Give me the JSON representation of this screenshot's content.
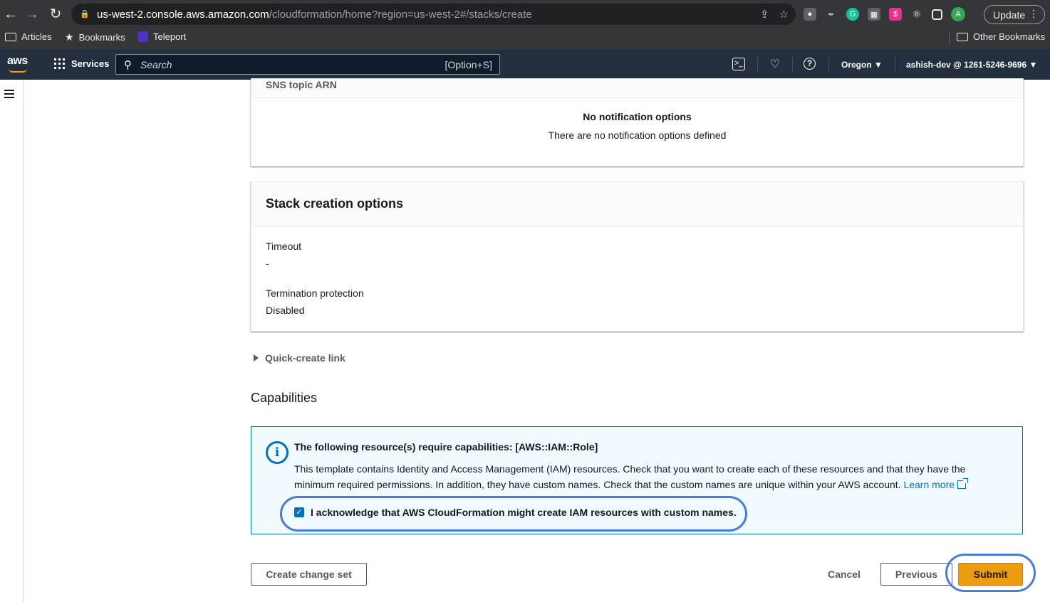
{
  "browser": {
    "url_host": "us-west-2.console.aws.amazon.com",
    "url_path": "/cloudformation/home?region=us-west-2#/stacks/create",
    "update_label": "Update",
    "avatar_letter": "A",
    "bookmarks": [
      {
        "label": "Articles",
        "icon": "folder-icon"
      },
      {
        "label": "Bookmarks",
        "icon": "star-icon"
      },
      {
        "label": "Teleport",
        "icon": "teleport-icon"
      }
    ],
    "other_bookmarks": "Other Bookmarks"
  },
  "aws_nav": {
    "logo": "aws",
    "services_label": "Services",
    "search_placeholder": "Search",
    "search_shortcut": "[Option+S]",
    "region": "Oregon",
    "account": "ashish-dev @ 1261-5246-9696"
  },
  "notifications": {
    "column_header": "SNS topic ARN",
    "empty_title": "No notification options",
    "empty_subtitle": "There are no notification options defined"
  },
  "stack_options": {
    "title": "Stack creation options",
    "timeout_label": "Timeout",
    "timeout_value": "-",
    "termination_label": "Termination protection",
    "termination_value": "Disabled"
  },
  "quick_create": {
    "label": "Quick-create link"
  },
  "capabilities": {
    "heading": "Capabilities",
    "info_title": "The following resource(s) require capabilities: [AWS::IAM::Role]",
    "info_body": "This template contains Identity and Access Management (IAM) resources. Check that you want to create each of these resources and that they have the minimum required permissions. In addition, they have custom names. Check that the custom names are unique within your AWS account.",
    "learn_more": "Learn more",
    "acknowledge_label": "I acknowledge that AWS CloudFormation might create IAM resources with custom names.",
    "acknowledged": true
  },
  "actions": {
    "create_change_set": "Create change set",
    "cancel": "Cancel",
    "previous": "Previous",
    "submit": "Submit"
  },
  "colors": {
    "aws_nav_bg": "#232f3e",
    "primary_button": "#ec9d0f",
    "info_border": "#0073bb",
    "highlight_ring": "#4a7bd9"
  }
}
